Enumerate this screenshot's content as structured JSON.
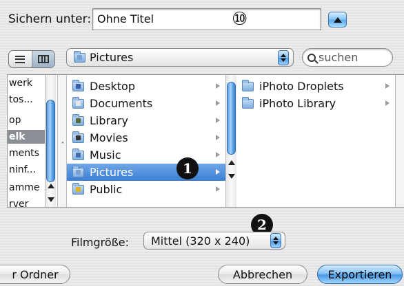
{
  "save_row": {
    "label": "Sichern unter:",
    "value": "Ohne Titel",
    "callout": "⑩"
  },
  "toolbar": {
    "path_popup": "Pictures",
    "search_placeholder": "suchen"
  },
  "columns": {
    "col1_items": [
      "werk",
      "tos...",
      "op",
      "elk",
      "ments",
      "ninf...",
      "amme",
      "rver"
    ],
    "col1_selected_index": 3,
    "col2_items": [
      {
        "label": "Desktop",
        "icon": "desktop-folder-icon",
        "badge_color": "#3a5fa8"
      },
      {
        "label": "Documents",
        "icon": "documents-folder-icon",
        "badge_color": "#e6e6e6"
      },
      {
        "label": "Library",
        "icon": "library-folder-icon",
        "badge_color": "#5a6a3a"
      },
      {
        "label": "Movies",
        "icon": "movies-folder-icon",
        "badge_color": "#333333"
      },
      {
        "label": "Music",
        "icon": "music-folder-icon",
        "badge_color": "#4a6fa8"
      },
      {
        "label": "Pictures",
        "icon": "pictures-folder-icon",
        "badge_color": "#7aa0d0"
      },
      {
        "label": "Public",
        "icon": "public-folder-icon",
        "badge_color": "#e0b020"
      }
    ],
    "col2_selected_index": 5,
    "col3_items": [
      {
        "label": "iPhoto Droplets",
        "icon": "folder-icon"
      },
      {
        "label": "iPhoto Library",
        "icon": "folder-icon"
      }
    ]
  },
  "callouts": {
    "one": "1",
    "two": "2"
  },
  "film_size": {
    "label": "Filmgröße:",
    "value": "Mittel (320 x 240)"
  },
  "buttons": {
    "new_folder": "r Ordner",
    "cancel": "Abbrechen",
    "export": "Exportieren"
  }
}
